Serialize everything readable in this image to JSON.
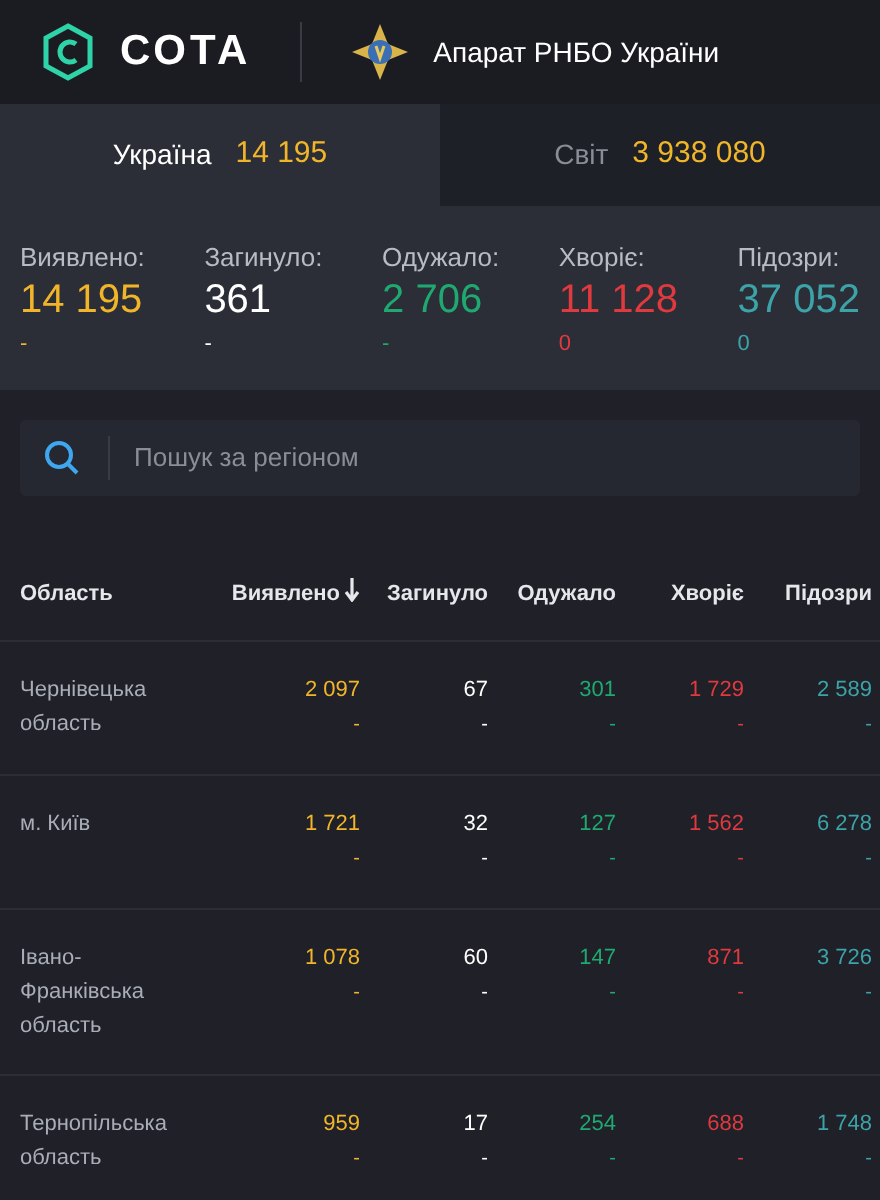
{
  "header": {
    "logo_text": "СОТА",
    "partner": "Апарат РНБО України"
  },
  "tabs": [
    {
      "label": "Україна",
      "count": "14 195",
      "selected": true
    },
    {
      "label": "Світ",
      "count": "3 938 080",
      "selected": false
    }
  ],
  "summary": [
    {
      "kind": "confirmed",
      "label": "Виявлено:",
      "value": "14 195",
      "delta": "-"
    },
    {
      "kind": "deaths",
      "label": "Загинуло:",
      "value": "361",
      "delta": "-"
    },
    {
      "kind": "recovered",
      "label": "Одужало:",
      "value": "2 706",
      "delta": "-"
    },
    {
      "kind": "active",
      "label": "Хворіє:",
      "value": "11 128",
      "delta": "0"
    },
    {
      "kind": "suspected",
      "label": "Підозри:",
      "value": "37 052",
      "delta": "0"
    }
  ],
  "search": {
    "placeholder": "Пошук за регіоном"
  },
  "table": {
    "columns": [
      {
        "label": "Область",
        "kind": "region",
        "sorted": false
      },
      {
        "label": "Виявлено",
        "kind": "confirmed",
        "sorted": true
      },
      {
        "label": "Загинуло",
        "kind": "deaths",
        "sorted": false
      },
      {
        "label": "Одужало",
        "kind": "recovered",
        "sorted": false
      },
      {
        "label": "Хворіє",
        "kind": "active",
        "sorted": false
      },
      {
        "label": "Підозри",
        "kind": "suspected",
        "sorted": false
      }
    ],
    "rows": [
      {
        "cells": [
          {
            "value": "Чернівецька область"
          },
          {
            "value": "2 097",
            "delta": "-"
          },
          {
            "value": "67",
            "delta": "-"
          },
          {
            "value": "301",
            "delta": "-"
          },
          {
            "value": "1 729",
            "delta": "-"
          },
          {
            "value": "2 589",
            "delta": "-"
          }
        ]
      },
      {
        "cells": [
          {
            "value": "м. Київ"
          },
          {
            "value": "1 721",
            "delta": "-"
          },
          {
            "value": "32",
            "delta": "-"
          },
          {
            "value": "127",
            "delta": "-"
          },
          {
            "value": "1 562",
            "delta": "-"
          },
          {
            "value": "6 278",
            "delta": "-"
          }
        ]
      },
      {
        "cells": [
          {
            "value": "Івано-Франківська область"
          },
          {
            "value": "1 078",
            "delta": "-"
          },
          {
            "value": "60",
            "delta": "-"
          },
          {
            "value": "147",
            "delta": "-"
          },
          {
            "value": "871",
            "delta": "-"
          },
          {
            "value": "3 726",
            "delta": "-"
          }
        ]
      },
      {
        "cells": [
          {
            "value": "Тернопільська область"
          },
          {
            "value": "959",
            "delta": "-"
          },
          {
            "value": "17",
            "delta": "-"
          },
          {
            "value": "254",
            "delta": "-"
          },
          {
            "value": "688",
            "delta": "-"
          },
          {
            "value": "1 748",
            "delta": "-"
          }
        ]
      }
    ]
  }
}
